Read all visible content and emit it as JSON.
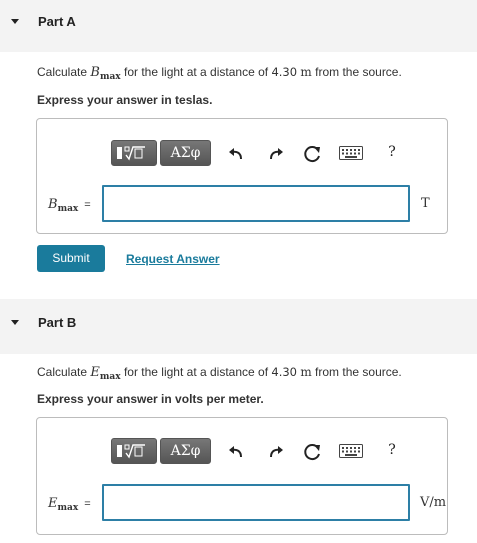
{
  "parts": [
    {
      "title": "Part A",
      "question_pre": "Calculate ",
      "question_var": "B",
      "question_sub": "max",
      "question_mid": " for the light at a distance of ",
      "question_num": "4.30",
      "question_unit": "m",
      "question_post": " from the source.",
      "instruction": "Express your answer in teslas.",
      "var_letter": "B",
      "var_sub": "max",
      "equals": "=",
      "input_value": "",
      "unit": "T"
    },
    {
      "title": "Part B",
      "question_pre": "Calculate ",
      "question_var": "E",
      "question_sub": "max",
      "question_mid": " for the light at a distance of ",
      "question_num": "4.30",
      "question_unit": "m",
      "question_post": " from the source.",
      "instruction": "Express your answer in volts per meter.",
      "var_letter": "E",
      "var_sub": "max",
      "equals": "=",
      "input_value": "",
      "unit": "V/m"
    }
  ],
  "toolbar": {
    "greek_label": "ΑΣφ",
    "undo_icon": "undo-arrow",
    "redo_icon": "redo-arrow",
    "reset_icon": "reset-circular-arrow",
    "keyboard_icon": "keyboard",
    "help_label": "?"
  },
  "actions": {
    "submit_label": "Submit",
    "request_label": "Request Answer"
  },
  "colors": {
    "accent": "#1a7b9c",
    "input_border": "#2d7fa6",
    "header_bg": "#f3f3f3",
    "toolbar_btn": "#666666"
  }
}
